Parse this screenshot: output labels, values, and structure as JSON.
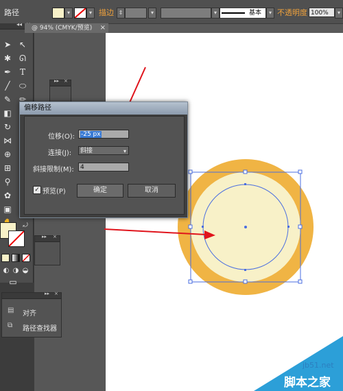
{
  "control_bar": {
    "label": "路径",
    "stroke_label": "描边",
    "stroke_style_label": "基本",
    "opacity_label": "不透明度",
    "opacity_value": "100%"
  },
  "document_tab": {
    "title": "@ 94% (CMYK/预览)",
    "close": "×"
  },
  "dialog": {
    "title": "偏移路径",
    "offset_label": "位移(O):",
    "offset_value": "-25 px",
    "join_label": "连接(J):",
    "join_value": "斜接",
    "miter_label": "斜接限制(M):",
    "miter_value": "4",
    "preview_label": "预览(P)",
    "preview_checked": true,
    "ok_button": "确定",
    "cancel_button": "取消"
  },
  "align_panel": {
    "items": [
      {
        "label": "对齐",
        "icon": "align-icon"
      },
      {
        "label": "路径查找器",
        "icon": "pathfinder-icon"
      }
    ]
  },
  "artwork": {
    "outer_circle_color": "#f0b444",
    "inner_circle_color": "#f8f1c8",
    "selection_color": "#4a6ee0"
  },
  "watermark": {
    "line1": "jb51.net",
    "line2": "脚本之家"
  }
}
